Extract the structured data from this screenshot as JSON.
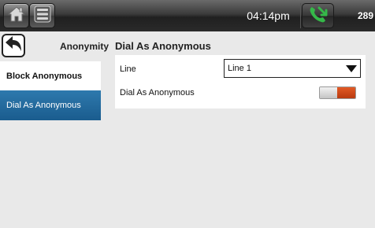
{
  "statusbar": {
    "time": "04:14pm",
    "extension": "289"
  },
  "icons": {
    "home": "home-icon",
    "menu": "menu-list-icon",
    "call": "phone-call-icon",
    "back": "back-arrow-icon",
    "dropdown": "chevron-down-icon"
  },
  "sidebar": {
    "title": "Anonymity",
    "items": [
      {
        "label": "Block Anonymous",
        "active": false
      },
      {
        "label": "Dial As Anonymous",
        "active": true
      }
    ]
  },
  "main": {
    "title": "Dial As Anonymous",
    "line": {
      "label": "Line",
      "value": "Line 1"
    },
    "dial_anonymous": {
      "label": "Dial As Anonymous",
      "enabled": true
    }
  },
  "colors": {
    "accent": "#1f6699",
    "toggle_on": "#d14a1c",
    "call_icon": "#35b849"
  }
}
